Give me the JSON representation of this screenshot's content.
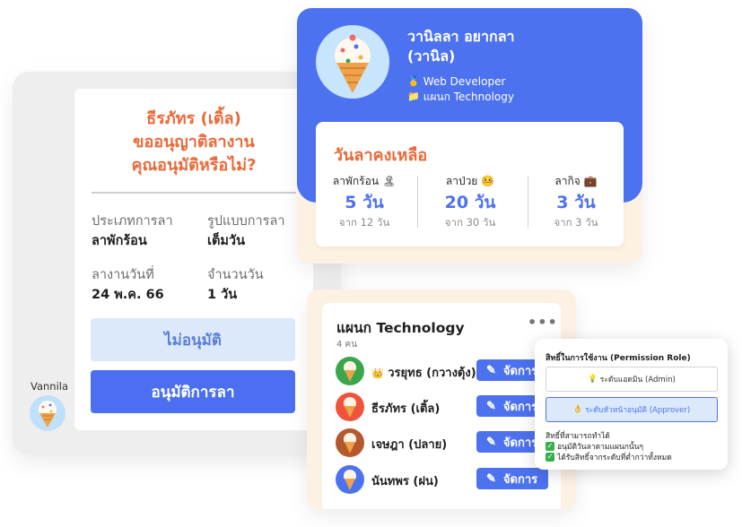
{
  "approval_request": {
    "requester": "ธีรภัทร (เติ้ล)",
    "question_line1": "ขออนุญาติลางาน",
    "question_line2": "คุณอนุมัติหรือไม่?",
    "fields": [
      {
        "label": "ประเภทการลา",
        "value": "ลาพักร้อน"
      },
      {
        "label": "รูปแบบการลา",
        "value": "เต็มวัน"
      },
      {
        "label": "ลางานวันที่",
        "value": "24 พ.ค. 66"
      },
      {
        "label": "จำนวนวัน",
        "value": "1 วัน"
      }
    ],
    "reject_label": "ไม่อนุมัติ",
    "approve_label": "อนุมัติการลา"
  },
  "current_user": {
    "name": "Vannila"
  },
  "profile": {
    "name_line1": "วานิลลา อยากลา",
    "name_line2": "(วานิล)",
    "role": "Web Developer",
    "department": "แผนก Technology"
  },
  "leave_balance": {
    "title": "วันลาคงเหลือ",
    "items": [
      {
        "type": "ลาพักร้อน",
        "icon": "🏝",
        "left": "5 วัน",
        "total": "จาก 12 วัน"
      },
      {
        "type": "ลาป่วย",
        "icon": "🤒",
        "left": "20 วัน",
        "total": "จาก 30 วัน"
      },
      {
        "type": "ลากิจ",
        "icon": "💼",
        "left": "3 วัน",
        "total": "จาก 3 วัน"
      }
    ]
  },
  "department": {
    "title": "แผนก Technology",
    "count": "4 คน",
    "members": [
      {
        "name": "วรยุทธ (กวางตุ้ง)",
        "crown": "👑",
        "avatar_color": "#3aa64b"
      },
      {
        "name": "ธีรภัทร (เติ้ล)",
        "avatar_color": "#f0533c"
      },
      {
        "name": "เจษฎา (ปลาย)",
        "avatar_color": "#b5582e"
      },
      {
        "name": "นันทพร (ฝน)",
        "avatar_color": "#4d72f0"
      }
    ],
    "manage_label": "จัดการ"
  },
  "permission": {
    "title": "สิทธิ์ในการใช้งาน (Permission Role)",
    "admin_label": "ระดับแอดมิน (Admin)",
    "approver_label": "ระดับหัวหน้าอนุมัติ (Approver)",
    "capabilities_title": "สิทธิ์ที่สามารถทำได้",
    "capabilities": [
      "อนุมัติวันลาตามแผนกนั้นๆ",
      "ได้รับสิทธิ์จากระดับที่ต่ำกว่าทั้งหมด"
    ]
  },
  "colors": {
    "brand_blue": "#4d72f0",
    "accent_orange": "#ea6a39",
    "reject_bg": "#dce9fb",
    "cream": "#fdf1e3"
  },
  "icons": {
    "role": "medal-icon",
    "department": "folder-icon",
    "more": "more-dots-icon",
    "edit": "pencil-icon",
    "admin": "bulb-icon",
    "approver": "approve-hand-icon",
    "check": "check-icon"
  }
}
